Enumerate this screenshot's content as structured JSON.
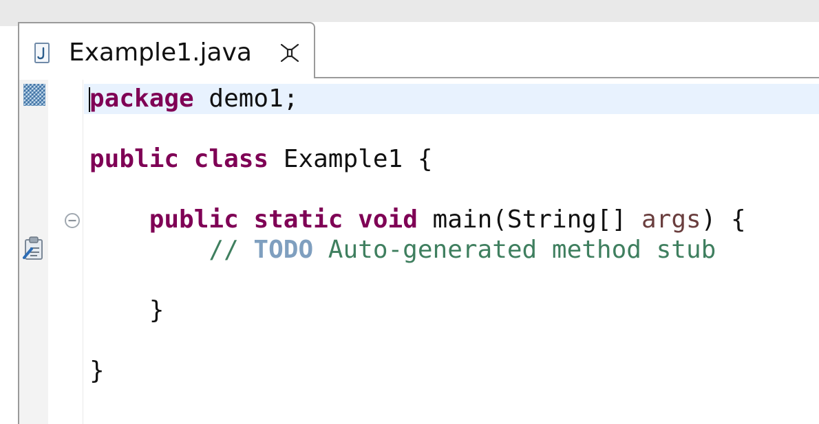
{
  "editor": {
    "tab": {
      "icon": "java-file-icon",
      "title": "Example1.java",
      "close_icon": "close-icon"
    },
    "gutter": {
      "bookmark_icon": "bookmark-icon",
      "task_icon": "task-marker-icon",
      "fold_icon": "fold-collapse-icon"
    },
    "code_lines": {
      "l1": {
        "kw1": "package",
        "rest": " demo1;"
      },
      "l3": {
        "kw1": "public",
        "sp1": " ",
        "kw2": "class",
        "rest": " Example1 {"
      },
      "l5": {
        "indent": "    ",
        "kw1": "public",
        "sp1": " ",
        "kw2": "static",
        "sp2": " ",
        "kw3": "void",
        "mid": " main(String[] ",
        "param": "args",
        "rest": ") {"
      },
      "l6": {
        "indent": "        ",
        "comment_start": "// ",
        "task": "TODO",
        "comment_rest": " Auto-generated method stub"
      },
      "l8": {
        "text": "    }"
      },
      "l10": {
        "text": "}"
      }
    }
  },
  "colors": {
    "keyword": "#7f0055",
    "comment": "#3f7f5f",
    "task_tag": "#7f9fbf",
    "parameter": "#6a3e3e",
    "current_line": "#e8f2fe"
  }
}
